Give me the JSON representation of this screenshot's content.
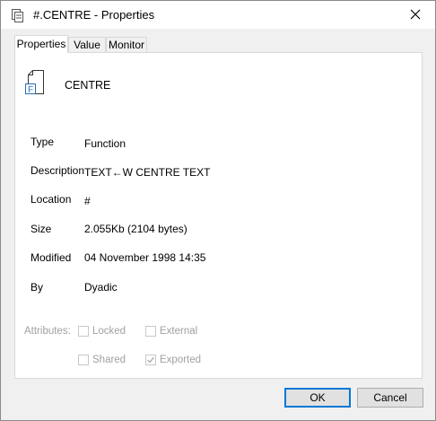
{
  "window": {
    "title": "#.CENTRE - Properties"
  },
  "tabs": [
    {
      "label": "Properties",
      "active": true
    },
    {
      "label": "Value",
      "active": false
    },
    {
      "label": "Monitor",
      "active": false
    }
  ],
  "object": {
    "name": "CENTRE",
    "icon": "function-file-icon"
  },
  "properties": {
    "type": {
      "label": "Type",
      "value": "Function"
    },
    "description": {
      "label": "Description",
      "value": "TEXT←W CENTRE TEXT"
    },
    "location": {
      "label": "Location",
      "value": "#"
    },
    "size": {
      "label": "Size",
      "value": "2.055Kb (2104 bytes)"
    },
    "modified": {
      "label": "Modified",
      "value": "04 November 1998 14:35"
    },
    "by": {
      "label": "By",
      "value": "Dyadic"
    }
  },
  "attributes": {
    "label": "Attributes:",
    "locked": {
      "label": "Locked",
      "checked": false
    },
    "external": {
      "label": "External",
      "checked": false
    },
    "shared": {
      "label": "Shared",
      "checked": false
    },
    "exported": {
      "label": "Exported",
      "checked": true
    }
  },
  "buttons": {
    "ok": "OK",
    "cancel": "Cancel"
  },
  "colors": {
    "accent": "#0078d7",
    "disabled_text": "#a0a0a0"
  }
}
